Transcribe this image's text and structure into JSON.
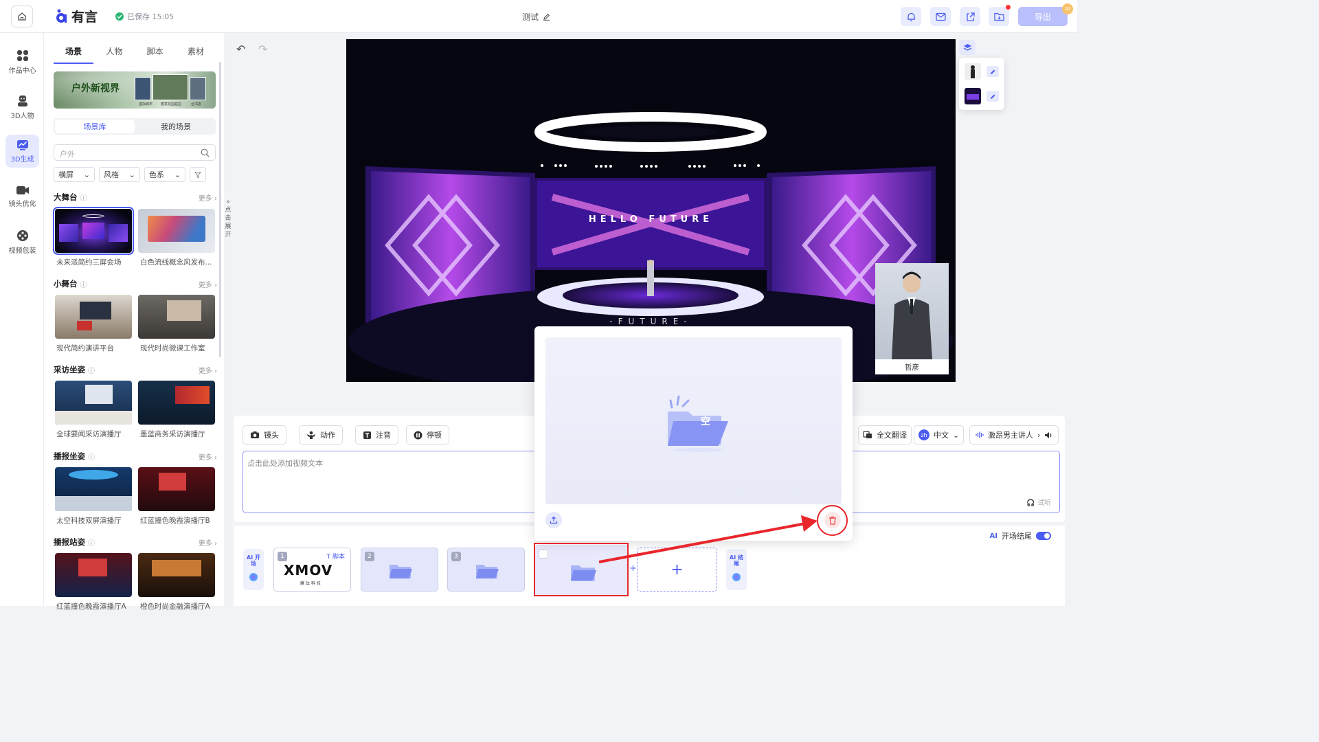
{
  "header": {
    "app_name": "有言",
    "saved_status": "已保存 15:05",
    "doc_title": "测试",
    "export_label": "导出",
    "notification_badge": "AI"
  },
  "rail": {
    "items": [
      {
        "label": "作品中心",
        "icon": "grid-icon"
      },
      {
        "label": "3D人物",
        "icon": "person-icon"
      },
      {
        "label": "3D生成",
        "icon": "chart-icon",
        "active": true
      },
      {
        "label": "镜头优化",
        "icon": "camera-icon"
      },
      {
        "label": "视频包装",
        "icon": "reel-icon"
      }
    ]
  },
  "panel": {
    "tabs": [
      "场景",
      "人物",
      "脚本",
      "素材"
    ],
    "active_tab": "场景",
    "banner_text": "户外新视界",
    "banner_captions": [
      "虚拟城市",
      "春意花园庭园",
      "台书店"
    ],
    "segments": [
      "场景库",
      "我的场景"
    ],
    "active_segment": "场景库",
    "search_placeholder": "户外",
    "filters": [
      "横屏",
      "风格",
      "色系"
    ],
    "more_label": "更多",
    "sections": [
      {
        "title": "大舞台",
        "items": [
          "未来派简约三屏会场",
          "白色流线概念风发布..."
        ]
      },
      {
        "title": "小舞台",
        "items": [
          "现代简约演讲平台",
          "现代时尚微课工作室"
        ]
      },
      {
        "title": "采访坐姿",
        "items": [
          "全球要闻采访演播厅",
          "墨蓝商务采访演播厅"
        ]
      },
      {
        "title": "播报坐姿",
        "items": [
          "太空科技双屏演播厅",
          "红蓝撞色晚霞演播厅B"
        ]
      },
      {
        "title": "播报站姿",
        "items": [
          "红蓝撞色晚霞演播厅A",
          "橙色时尚金融演播厅A"
        ]
      }
    ],
    "expand_hint": "点击展开"
  },
  "stage": {
    "screen_title": "HELLO FUTURE",
    "floor_text": "-FUTURE-",
    "avatar_name": "哲彦"
  },
  "script": {
    "tools": [
      "镜头",
      "动作",
      "注音",
      "停顿"
    ],
    "translate_label": "全文翻译",
    "lang_code": "zh",
    "lang_label": "中文",
    "voice_label": "激昂男主讲人",
    "text_placeholder": "点击此处添加视频文本",
    "listen_label": "试听"
  },
  "timeline": {
    "opening_toggle_label": "开场结尾",
    "ai_start": "AI 开场",
    "ai_end": "AI 结尾",
    "clips": [
      {
        "num": "1",
        "tag": "脚本",
        "brand": "XMOV",
        "brand_sub": "魔 珐 科 技"
      },
      {
        "num": "2"
      },
      {
        "num": "3"
      },
      {
        "num": ""
      }
    ],
    "add_label": "+"
  },
  "popup": {
    "empty_label": "空"
  },
  "colors": {
    "accent": "#4b5cf0",
    "annotation_red": "#e8262c"
  }
}
